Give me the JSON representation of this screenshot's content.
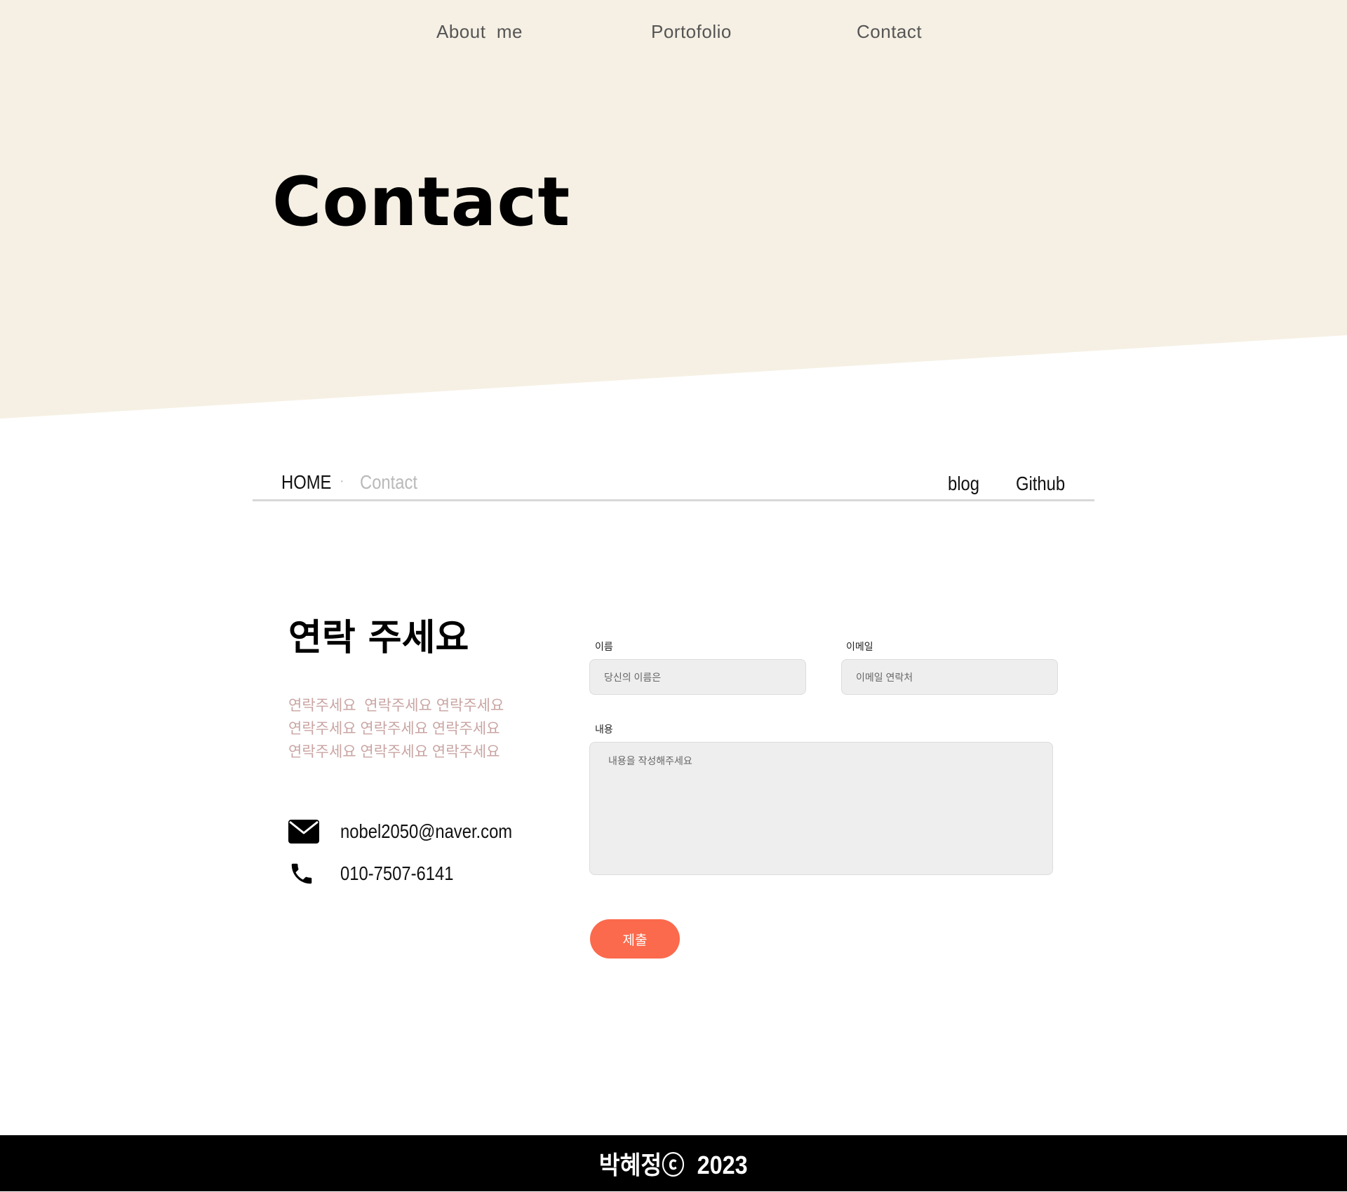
{
  "nav": {
    "items": [
      {
        "label": "About  me"
      },
      {
        "label": "Portofolio"
      },
      {
        "label": "Contact"
      }
    ]
  },
  "hero": {
    "title": "Contact",
    "background_color": "#f6f0e4"
  },
  "breadcrumb": {
    "home": "HOME",
    "separator": "·",
    "current": "Contact"
  },
  "links": {
    "blog": "blog",
    "github": "Github"
  },
  "contact_info": {
    "title": "연락 주세요",
    "description_lines": [
      "연락주세요  연락주세요 연락주세요",
      "연락주세요 연락주세요 연락주세요",
      "연락주세요 연락주세요 연락주세요"
    ],
    "email": "nobel2050@naver.com",
    "phone": "010-7507-6141",
    "email_icon": "envelope-icon",
    "phone_icon": "phone-icon"
  },
  "form": {
    "name_label": "이름",
    "name_placeholder": "당신의 이름은",
    "email_label": "이메일",
    "email_placeholder": "이메일 연락처",
    "content_label": "내용",
    "content_placeholder": "내용을 작성해주세요",
    "submit_label": "제출",
    "submit_color": "#fb6a4c"
  },
  "footer": {
    "text": "박혜정ⓒ  2023"
  }
}
